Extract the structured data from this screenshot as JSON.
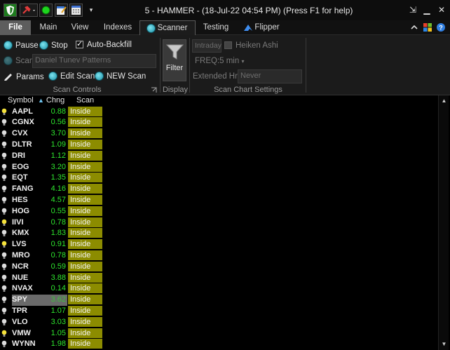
{
  "window": {
    "title": "5 - HAMMER - (18-Jul-22 04:54 PM) (Press F1 for help)"
  },
  "menu": {
    "tabs": [
      {
        "label": "File"
      },
      {
        "label": "Main"
      },
      {
        "label": "View"
      },
      {
        "label": "Indexes"
      },
      {
        "label": "Scanner"
      },
      {
        "label": "Testing"
      },
      {
        "label": "Flipper"
      }
    ]
  },
  "ribbon": {
    "pause_label": "Pause",
    "stop_label": "Stop",
    "auto_backfill_label": "Auto-Backfill",
    "auto_backfill_checked": true,
    "scan_label": "Scan",
    "scan_value": "Daniel Tunev Patterns",
    "params_label": "Params",
    "edit_scan_label": "Edit Scan",
    "new_scan_label": "NEW Scan",
    "scan_controls_label": "Scan Controls",
    "filter_label": "Filter",
    "display_label": "Display",
    "intraday_label": "Intraday",
    "heiken_ashi_label": "Heiken Ashi",
    "freq_label": "FREQ:5 min",
    "extended_hrs_label": "Extended Hrs:",
    "extended_hrs_value": "Never",
    "scan_chart_settings_label": "Scan Chart Settings"
  },
  "grid": {
    "headers": {
      "symbol": "Symbol",
      "chng": "Chng",
      "scan": "Scan"
    },
    "rows": [
      {
        "symbol": "AAPL",
        "chng": "0.88",
        "scan": "Inside",
        "lit": true
      },
      {
        "symbol": "CGNX",
        "chng": "0.56",
        "scan": "Inside",
        "lit": false
      },
      {
        "symbol": "CVX",
        "chng": "3.70",
        "scan": "Inside",
        "lit": false
      },
      {
        "symbol": "DLTR",
        "chng": "1.09",
        "scan": "Inside",
        "lit": false
      },
      {
        "symbol": "DRI",
        "chng": "1.12",
        "scan": "Inside",
        "lit": false
      },
      {
        "symbol": "EOG",
        "chng": "3.20",
        "scan": "Inside",
        "lit": false
      },
      {
        "symbol": "EQT",
        "chng": "1.35",
        "scan": "Inside",
        "lit": false
      },
      {
        "symbol": "FANG",
        "chng": "4.16",
        "scan": "Inside",
        "lit": false
      },
      {
        "symbol": "HES",
        "chng": "4.57",
        "scan": "Inside",
        "lit": false
      },
      {
        "symbol": "HOG",
        "chng": "0.55",
        "scan": "Inside",
        "lit": false
      },
      {
        "symbol": "IIVI",
        "chng": "0.78",
        "scan": "Inside",
        "lit": true
      },
      {
        "symbol": "KMX",
        "chng": "1.83",
        "scan": "Inside",
        "lit": false
      },
      {
        "symbol": "LVS",
        "chng": "0.91",
        "scan": "Inside",
        "lit": true
      },
      {
        "symbol": "MRO",
        "chng": "0.78",
        "scan": "Inside",
        "lit": false
      },
      {
        "symbol": "NCR",
        "chng": "0.59",
        "scan": "Inside",
        "lit": false
      },
      {
        "symbol": "NUE",
        "chng": "3.88",
        "scan": "Inside",
        "lit": false
      },
      {
        "symbol": "NVAX",
        "chng": "0.14",
        "scan": "Inside",
        "lit": false
      },
      {
        "symbol": "SPY",
        "chng": "3.62",
        "scan": "Inside",
        "lit": false,
        "selected": true
      },
      {
        "symbol": "TPR",
        "chng": "1.07",
        "scan": "Inside",
        "lit": false
      },
      {
        "symbol": "VLO",
        "chng": "3.03",
        "scan": "Inside",
        "lit": false
      },
      {
        "symbol": "VMW",
        "chng": "1.05",
        "scan": "Inside",
        "lit": true
      },
      {
        "symbol": "WYNN",
        "chng": "1.98",
        "scan": "Inside",
        "lit": false
      }
    ]
  },
  "colors": {
    "scan_cell": "#8c8c00",
    "change_text": "#2ee62e",
    "selected_row": "#6a6a6a"
  }
}
